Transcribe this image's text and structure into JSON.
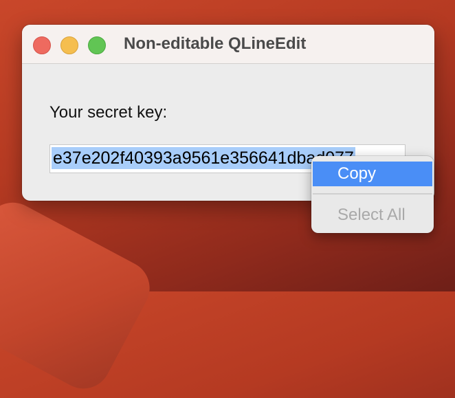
{
  "window": {
    "title": "Non-editable QLineEdit"
  },
  "form": {
    "label": "Your secret key:",
    "lineedit_value": "e37e202f40393a9561e356641dbad077"
  },
  "context_menu": {
    "items": [
      {
        "label": "Copy",
        "enabled": true,
        "highlighted": true
      },
      {
        "label": "Select All",
        "enabled": false,
        "highlighted": false
      }
    ]
  },
  "colors": {
    "selection": "#a8cdfa",
    "menu_highlight": "#4a8ef6",
    "close": "#ee6a5f",
    "minimize": "#f5be4f",
    "maximize": "#61c554"
  }
}
